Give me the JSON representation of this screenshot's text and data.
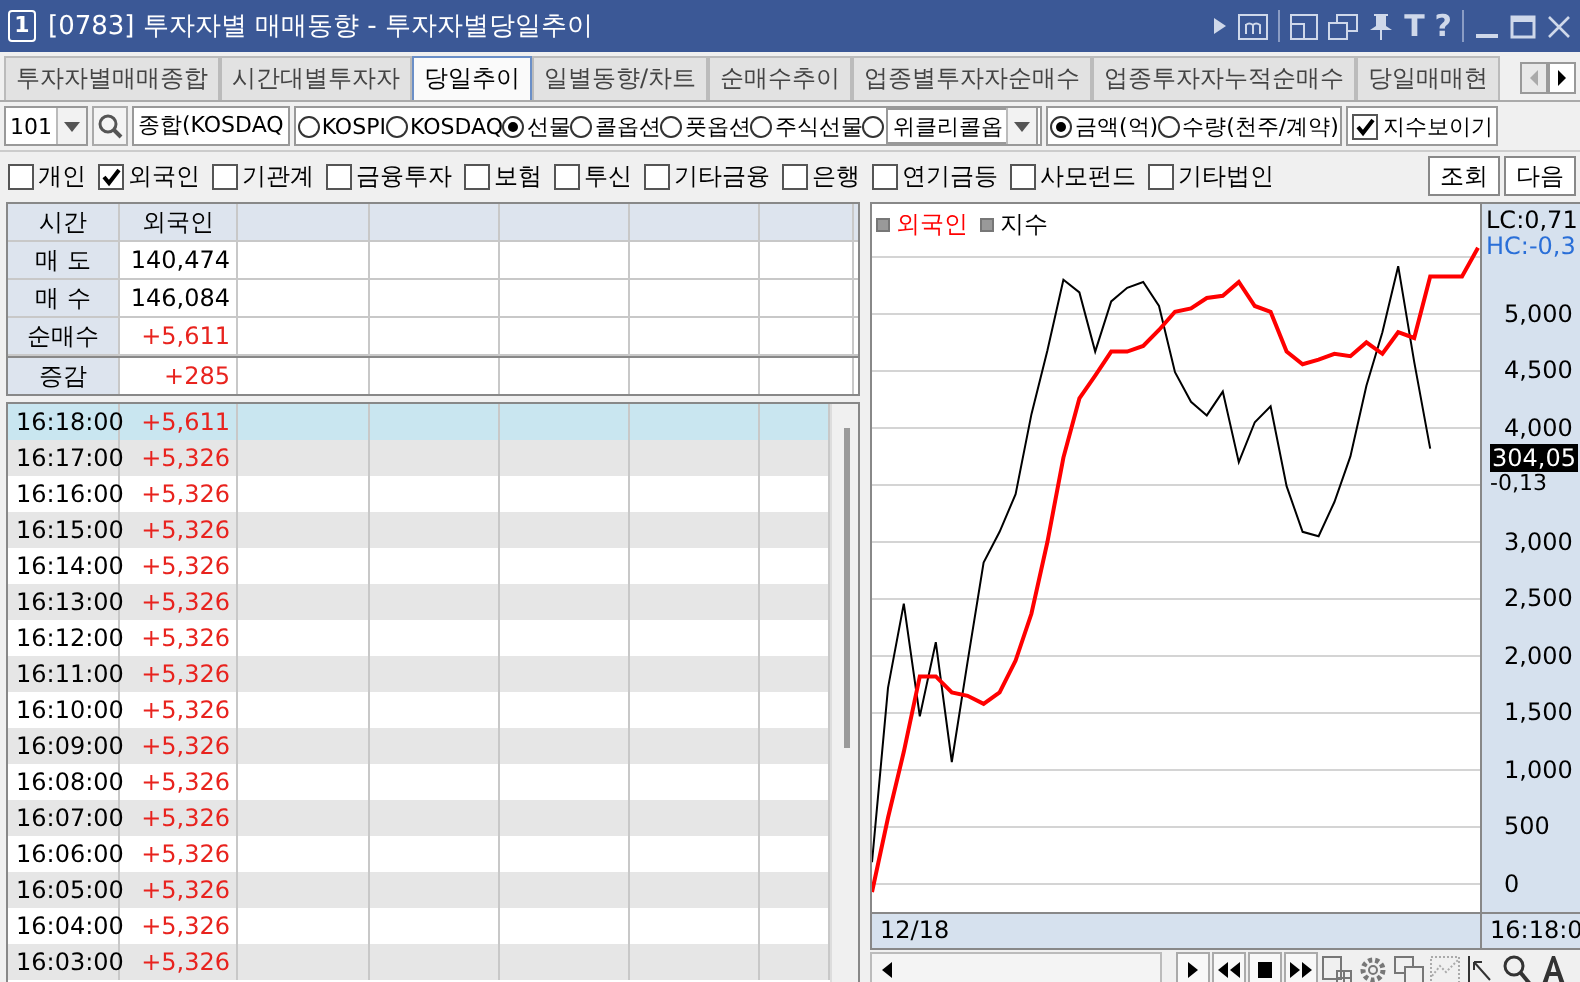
{
  "window": {
    "badge": "1",
    "title": "[0783] 투자자별 매매동향 - 투자자별당일추이",
    "tools": [
      "T",
      "?"
    ]
  },
  "tabs": [
    {
      "label": "투자자별매매종합",
      "selected": false
    },
    {
      "label": "시간대별투자자",
      "selected": false
    },
    {
      "label": "당일추이",
      "selected": true
    },
    {
      "label": "일별동향/차트",
      "selected": false
    },
    {
      "label": "순매수추이",
      "selected": false
    },
    {
      "label": "업종별투자자순매수",
      "selected": false
    },
    {
      "label": "업종투자자누적순매수",
      "selected": false
    },
    {
      "label": "당일매매현",
      "selected": false
    }
  ],
  "toolbar": {
    "code": "101",
    "name": "종합(KOSDAQ",
    "markets": [
      {
        "label": "KOSPI",
        "selected": false,
        "kind": "radio"
      },
      {
        "label": "KOSDAQ",
        "selected": false,
        "kind": "radio"
      },
      {
        "label": "선물",
        "selected": true,
        "kind": "radio"
      },
      {
        "label": "콜옵션",
        "selected": false,
        "kind": "radio"
      },
      {
        "label": "풋옵션",
        "selected": false,
        "kind": "radio"
      },
      {
        "label": "주식선물",
        "selected": false,
        "kind": "radio"
      },
      {
        "label": "위클리콜옵",
        "selected": false,
        "kind": "combo"
      }
    ],
    "units": [
      {
        "label": "금액(억)",
        "selected": true
      },
      {
        "label": "수량(천주/계약)",
        "selected": false
      }
    ],
    "show_index": {
      "label": "지수보이기",
      "checked": true
    }
  },
  "investors": [
    {
      "label": "개인",
      "checked": false
    },
    {
      "label": "외국인",
      "checked": true
    },
    {
      "label": "기관계",
      "checked": false
    },
    {
      "label": "금융투자",
      "checked": false
    },
    {
      "label": "보험",
      "checked": false
    },
    {
      "label": "투신",
      "checked": false
    },
    {
      "label": "기타금융",
      "checked": false
    },
    {
      "label": "은행",
      "checked": false
    },
    {
      "label": "연기금등",
      "checked": false
    },
    {
      "label": "사모펀드",
      "checked": false
    },
    {
      "label": "기타법인",
      "checked": false
    }
  ],
  "buttons": [
    "조회",
    "다음"
  ],
  "summary": {
    "columns": [
      "시간",
      "외국인"
    ],
    "rows": [
      {
        "label": "매 도",
        "value": "140,474",
        "color": "#000000"
      },
      {
        "label": "매 수",
        "value": "146,084",
        "color": "#000000"
      },
      {
        "label": "순매수",
        "value": "+5,611",
        "color": "#e8231e"
      },
      {
        "label": "증감",
        "value": "+285",
        "color": "#e8231e"
      }
    ]
  },
  "ticks": [
    {
      "time": "16:18:00",
      "value": "+5,611",
      "selected": true
    },
    {
      "time": "16:17:00",
      "value": "+5,326",
      "selected": false
    },
    {
      "time": "16:16:00",
      "value": "+5,326",
      "selected": false
    },
    {
      "time": "16:15:00",
      "value": "+5,326",
      "selected": false
    },
    {
      "time": "16:14:00",
      "value": "+5,326",
      "selected": false
    },
    {
      "time": "16:13:00",
      "value": "+5,326",
      "selected": false
    },
    {
      "time": "16:12:00",
      "value": "+5,326",
      "selected": false
    },
    {
      "time": "16:11:00",
      "value": "+5,326",
      "selected": false
    },
    {
      "time": "16:10:00",
      "value": "+5,326",
      "selected": false
    },
    {
      "time": "16:09:00",
      "value": "+5,326",
      "selected": false
    },
    {
      "time": "16:08:00",
      "value": "+5,326",
      "selected": false
    },
    {
      "time": "16:07:00",
      "value": "+5,326",
      "selected": false
    },
    {
      "time": "16:06:00",
      "value": "+5,326",
      "selected": false
    },
    {
      "time": "16:05:00",
      "value": "+5,326",
      "selected": false
    },
    {
      "time": "16:04:00",
      "value": "+5,326",
      "selected": false
    },
    {
      "time": "16:03:00",
      "value": "+5,326",
      "selected": false
    }
  ],
  "chart": {
    "chart_data": {
      "type": "line",
      "grid": true,
      "ylim": [
        -246,
        5965
      ],
      "yticks": [
        {
          "value": 5000,
          "label": "5,000"
        },
        {
          "value": 4500,
          "label": "4,500"
        },
        {
          "value": 4000,
          "label": "4,000"
        },
        {
          "value": 3000,
          "label": "3,000"
        },
        {
          "value": 2500,
          "label": "2,500"
        },
        {
          "value": 2000,
          "label": "2,000"
        },
        {
          "value": 1500,
          "label": "1,500"
        },
        {
          "value": 1000,
          "label": "1,000"
        },
        {
          "value": 500,
          "label": "500"
        },
        {
          "value": 0,
          "label": "0"
        }
      ],
      "series": [
        {
          "name": "외국인",
          "color": "#ff0000",
          "values": [
            -70,
            580,
            1160,
            1820,
            1820,
            1680,
            1650,
            1580,
            1680,
            1960,
            2370,
            3000,
            3740,
            4260,
            4460,
            4670,
            4670,
            4720,
            4860,
            5020,
            5050,
            5140,
            5160,
            5280,
            5070,
            5020,
            4670,
            4560,
            4600,
            4650,
            4630,
            4750,
            4650,
            4840,
            4790,
            5330,
            5330,
            5330,
            5580
          ]
        },
        {
          "name": "지수",
          "color": "#000000",
          "values": [
            190,
            1720,
            2460,
            1470,
            2120,
            1070,
            1950,
            2820,
            3090,
            3420,
            4120,
            4680,
            5300,
            5190,
            4670,
            5110,
            5230,
            5280,
            5070,
            4490,
            4230,
            4110,
            4320,
            3700,
            4050,
            4190,
            3490,
            3090,
            3050,
            3350,
            3750,
            4370,
            4840,
            5420,
            4580,
            3820,
            null,
            null,
            null
          ]
        }
      ]
    },
    "lc": "LC:0,71",
    "hc": "HC:-0,3",
    "price": "304,05",
    "change": "-0,13",
    "start": "12/18",
    "end": "16:18:0"
  }
}
